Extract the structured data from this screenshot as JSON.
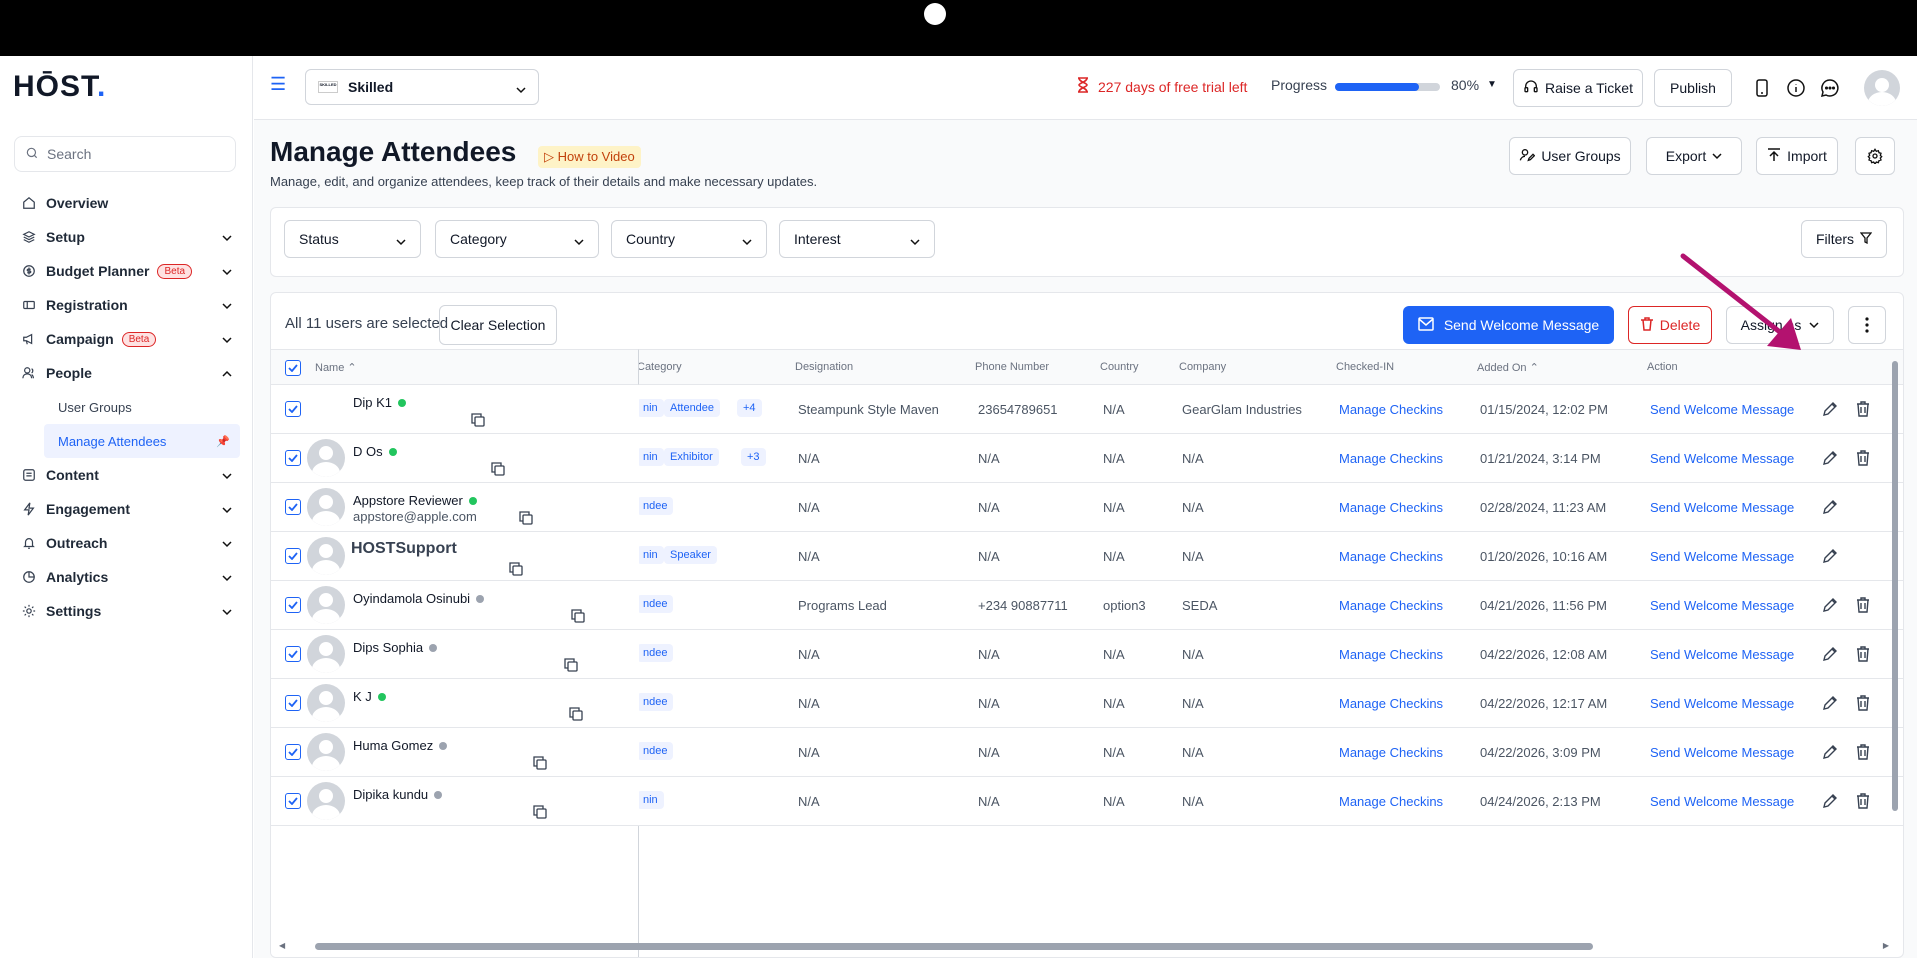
{
  "sidebar": {
    "logo": "HŌST",
    "logo_dot": ".",
    "search_placeholder": "Search",
    "nav": [
      {
        "label": "Overview",
        "icon": "home-icon"
      },
      {
        "label": "Setup",
        "icon": "layers-icon"
      },
      {
        "label": "Budget Planner",
        "icon": "dollar-icon",
        "badge": "Beta"
      },
      {
        "label": "Registration",
        "icon": "ticket-icon"
      },
      {
        "label": "Campaign",
        "icon": "megaphone-icon",
        "badge": "Beta"
      },
      {
        "label": "People",
        "icon": "users-icon"
      },
      {
        "label": "Content",
        "icon": "content-icon"
      },
      {
        "label": "Engagement",
        "icon": "bolt-icon"
      },
      {
        "label": "Outreach",
        "icon": "bell-icon"
      },
      {
        "label": "Analytics",
        "icon": "chart-icon"
      },
      {
        "label": "Settings",
        "icon": "gear-icon"
      }
    ],
    "people_sub": [
      "User Groups",
      "Manage Attendees"
    ]
  },
  "header": {
    "event_name": "Skilled",
    "event_thumb": "SKILLED",
    "trial": "227 days of free trial left",
    "progress_label": "Progress",
    "progress_value": "80%",
    "progress_fraction": 0.8,
    "raise_ticket": "Raise a Ticket",
    "publish": "Publish"
  },
  "page": {
    "title": "Manage Attendees",
    "how_to": "How to Video",
    "subtitle": "Manage, edit, and organize attendees, keep track of their details and make necessary updates.",
    "user_groups": "User Groups",
    "export": "Export",
    "import": "Import"
  },
  "filters": {
    "status": "Status",
    "category": "Category",
    "country": "Country",
    "interest": "Interest",
    "filters_btn": "Filters"
  },
  "table": {
    "selection_text": "All 11 users are selected",
    "clear_selection": "Clear Selection",
    "welcome_btn": "Send Welcome Message",
    "delete_btn": "Delete",
    "assign_btn": "Assign as",
    "columns": {
      "name": "Name",
      "category": "Category",
      "designation": "Designation",
      "phone": "Phone Number",
      "country": "Country",
      "company": "Company",
      "checked_in": "Checked-IN",
      "added_on": "Added On",
      "action": "Action"
    },
    "rows": [
      {
        "name": "Dip K1",
        "email": "",
        "online": true,
        "cat1": "nin",
        "cat2": "Attendee",
        "cat3": "+4",
        "designation": "Steampunk Style Maven",
        "phone": "23654789651",
        "country": "N/A",
        "company": "GearGlam Industries",
        "checkin": "Manage Checkins",
        "added": "01/15/2024, 12:02 PM",
        "action": "Send Welcome Message",
        "deletable": true
      },
      {
        "name": "D Os",
        "email": "",
        "online": true,
        "cat1": "nin",
        "cat2": "Exhibitor",
        "cat3": "+3",
        "designation": "N/A",
        "phone": "N/A",
        "country": "N/A",
        "company": "N/A",
        "checkin": "Manage Checkins",
        "added": "01/21/2024, 3:14 PM",
        "action": "Send Welcome Message",
        "deletable": true
      },
      {
        "name": "Appstore Reviewer",
        "email": "appstore@apple.com",
        "online": true,
        "cat1": "ndee",
        "cat2": "",
        "cat3": "",
        "designation": "N/A",
        "phone": "N/A",
        "country": "N/A",
        "company": "N/A",
        "checkin": "Manage Checkins",
        "added": "02/28/2024, 11:23 AM",
        "action": "Send Welcome Message",
        "deletable": false
      },
      {
        "name": "HOSTSupport",
        "email": "",
        "online": null,
        "cat1": "nin",
        "cat2": "Speaker",
        "cat3": "",
        "designation": "N/A",
        "phone": "N/A",
        "country": "N/A",
        "company": "N/A",
        "checkin": "Manage Checkins",
        "added": "01/20/2026, 10:16 AM",
        "action": "Send Welcome Message",
        "deletable": false
      },
      {
        "name": "Oyindamola Osinubi",
        "email": "",
        "online": false,
        "cat1": "ndee",
        "cat2": "",
        "cat3": "",
        "designation": "Programs Lead",
        "phone": "+234 90887711",
        "country": "option3",
        "company": "SEDA",
        "checkin": "Manage Checkins",
        "added": "04/21/2026, 11:56 PM",
        "action": "Send Welcome Message",
        "deletable": true
      },
      {
        "name": "Dips Sophia",
        "email": "",
        "online": false,
        "cat1": "ndee",
        "cat2": "",
        "cat3": "",
        "designation": "N/A",
        "phone": "N/A",
        "country": "N/A",
        "company": "N/A",
        "checkin": "Manage Checkins",
        "added": "04/22/2026, 12:08 AM",
        "action": "Send Welcome Message",
        "deletable": true
      },
      {
        "name": "K J",
        "email": "",
        "online": true,
        "cat1": "ndee",
        "cat2": "",
        "cat3": "",
        "designation": "N/A",
        "phone": "N/A",
        "country": "N/A",
        "company": "N/A",
        "checkin": "Manage Checkins",
        "added": "04/22/2026, 12:17 AM",
        "action": "Send Welcome Message",
        "deletable": true
      },
      {
        "name": "Huma Gomez",
        "email": "",
        "online": false,
        "cat1": "ndee",
        "cat2": "",
        "cat3": "",
        "designation": "N/A",
        "phone": "N/A",
        "country": "N/A",
        "company": "N/A",
        "checkin": "Manage Checkins",
        "added": "04/22/2026, 3:09 PM",
        "action": "Send Welcome Message",
        "deletable": true
      },
      {
        "name": "Dipika kundu",
        "email": "",
        "online": false,
        "cat1": "nin",
        "cat2": "",
        "cat3": "",
        "designation": "N/A",
        "phone": "N/A",
        "country": "N/A",
        "company": "N/A",
        "checkin": "Manage Checkins",
        "added": "04/24/2026, 2:13 PM",
        "action": "Send Welcome Message",
        "deletable": true
      }
    ]
  },
  "colors": {
    "accent": "#1e63f5",
    "danger": "#dc2626",
    "arrow": "#b3126f"
  }
}
